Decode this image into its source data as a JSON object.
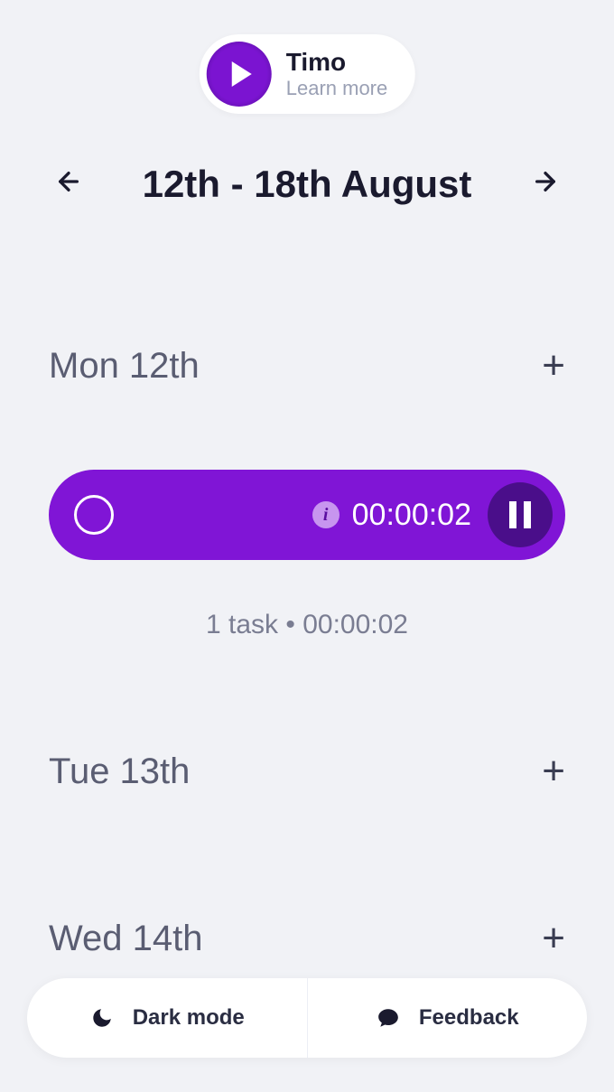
{
  "header": {
    "app_name": "Timo",
    "subtitle": "Learn more"
  },
  "week": {
    "range_label": "12th - 18th August"
  },
  "days": [
    {
      "label": "Mon 12th",
      "has_timer": true
    },
    {
      "label": "Tue 13th",
      "has_timer": false
    },
    {
      "label": "Wed 14th",
      "has_timer": false
    }
  ],
  "timer": {
    "elapsed": "00:00:02",
    "info_glyph": "i"
  },
  "summary": {
    "text": "1 task • 00:00:02"
  },
  "footer": {
    "dark_mode_label": "Dark mode",
    "feedback_label": "Feedback"
  },
  "colors": {
    "accent": "#8015d6",
    "accent_dark": "#4a0e8a",
    "text_muted": "#7a7d92"
  }
}
